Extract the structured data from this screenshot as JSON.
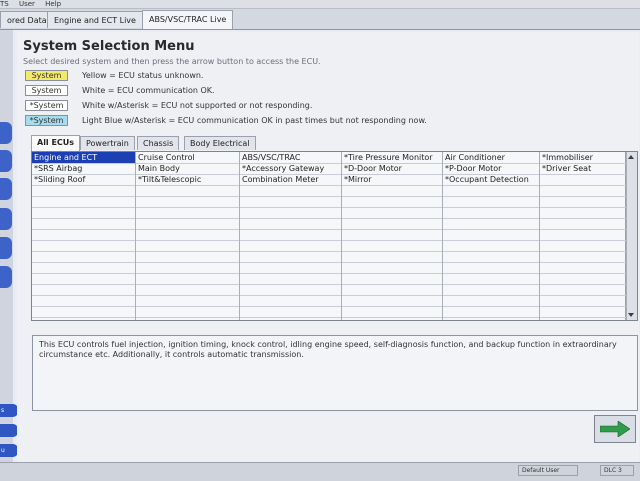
{
  "menubar": {
    "items": [
      "TS",
      "User",
      "Help"
    ]
  },
  "window_tabs": [
    "ored Data",
    "Engine and ECT Live",
    "ABS/VSC/TRAC Live"
  ],
  "left_rail": {
    "small_buttons": [
      "s",
      "",
      "u"
    ]
  },
  "page": {
    "title": "System Selection Menu",
    "subtitle": "Select desired system and then press the arrow button to access the ECU."
  },
  "legend": [
    {
      "chip": "System",
      "text": "Yellow = ECU status unknown.",
      "color": "#f3ea6c"
    },
    {
      "chip": "System",
      "text": "White = ECU communication OK.",
      "color": "#ffffff"
    },
    {
      "chip": "*System",
      "text": "White w/Asterisk = ECU not supported or not responding.",
      "color": "#ffffff"
    },
    {
      "chip": "*System",
      "text": "Light Blue w/Asterisk = ECU communication OK in past times but not responding now.",
      "color": "#a6dced"
    }
  ],
  "ecu_tabs": [
    "All ECUs",
    "Powertrain",
    "Chassis",
    "Body Electrical"
  ],
  "grid": {
    "rows": [
      [
        "Engine and ECT",
        "Cruise Control",
        "ABS/VSC/TRAC",
        "*Tire Pressure Monitor",
        "Air Conditioner",
        "*Immobiliser"
      ],
      [
        "*SRS Airbag",
        "Main Body",
        "*Accessory Gateway",
        "*D-Door Motor",
        "*P-Door Motor",
        "*Driver Seat"
      ],
      [
        "*Sliding Roof",
        "*Tilt&Telescopic",
        "Combination Meter",
        "*Mirror",
        "*Occupant Detection",
        ""
      ]
    ],
    "selected": "Engine and ECT"
  },
  "description": "This ECU controls fuel injection, ignition timing, knock control, idling engine speed, self-diagnosis function, and backup function in extraordinary circumstance etc. Additionally, it controls automatic transmission.",
  "statusbar": {
    "user": "Default User",
    "dlc": "DLC 3"
  },
  "colors": {
    "selected": "#1d3fb4",
    "accent": "#3d63c9",
    "next_arrow": "#2e9c4a"
  }
}
